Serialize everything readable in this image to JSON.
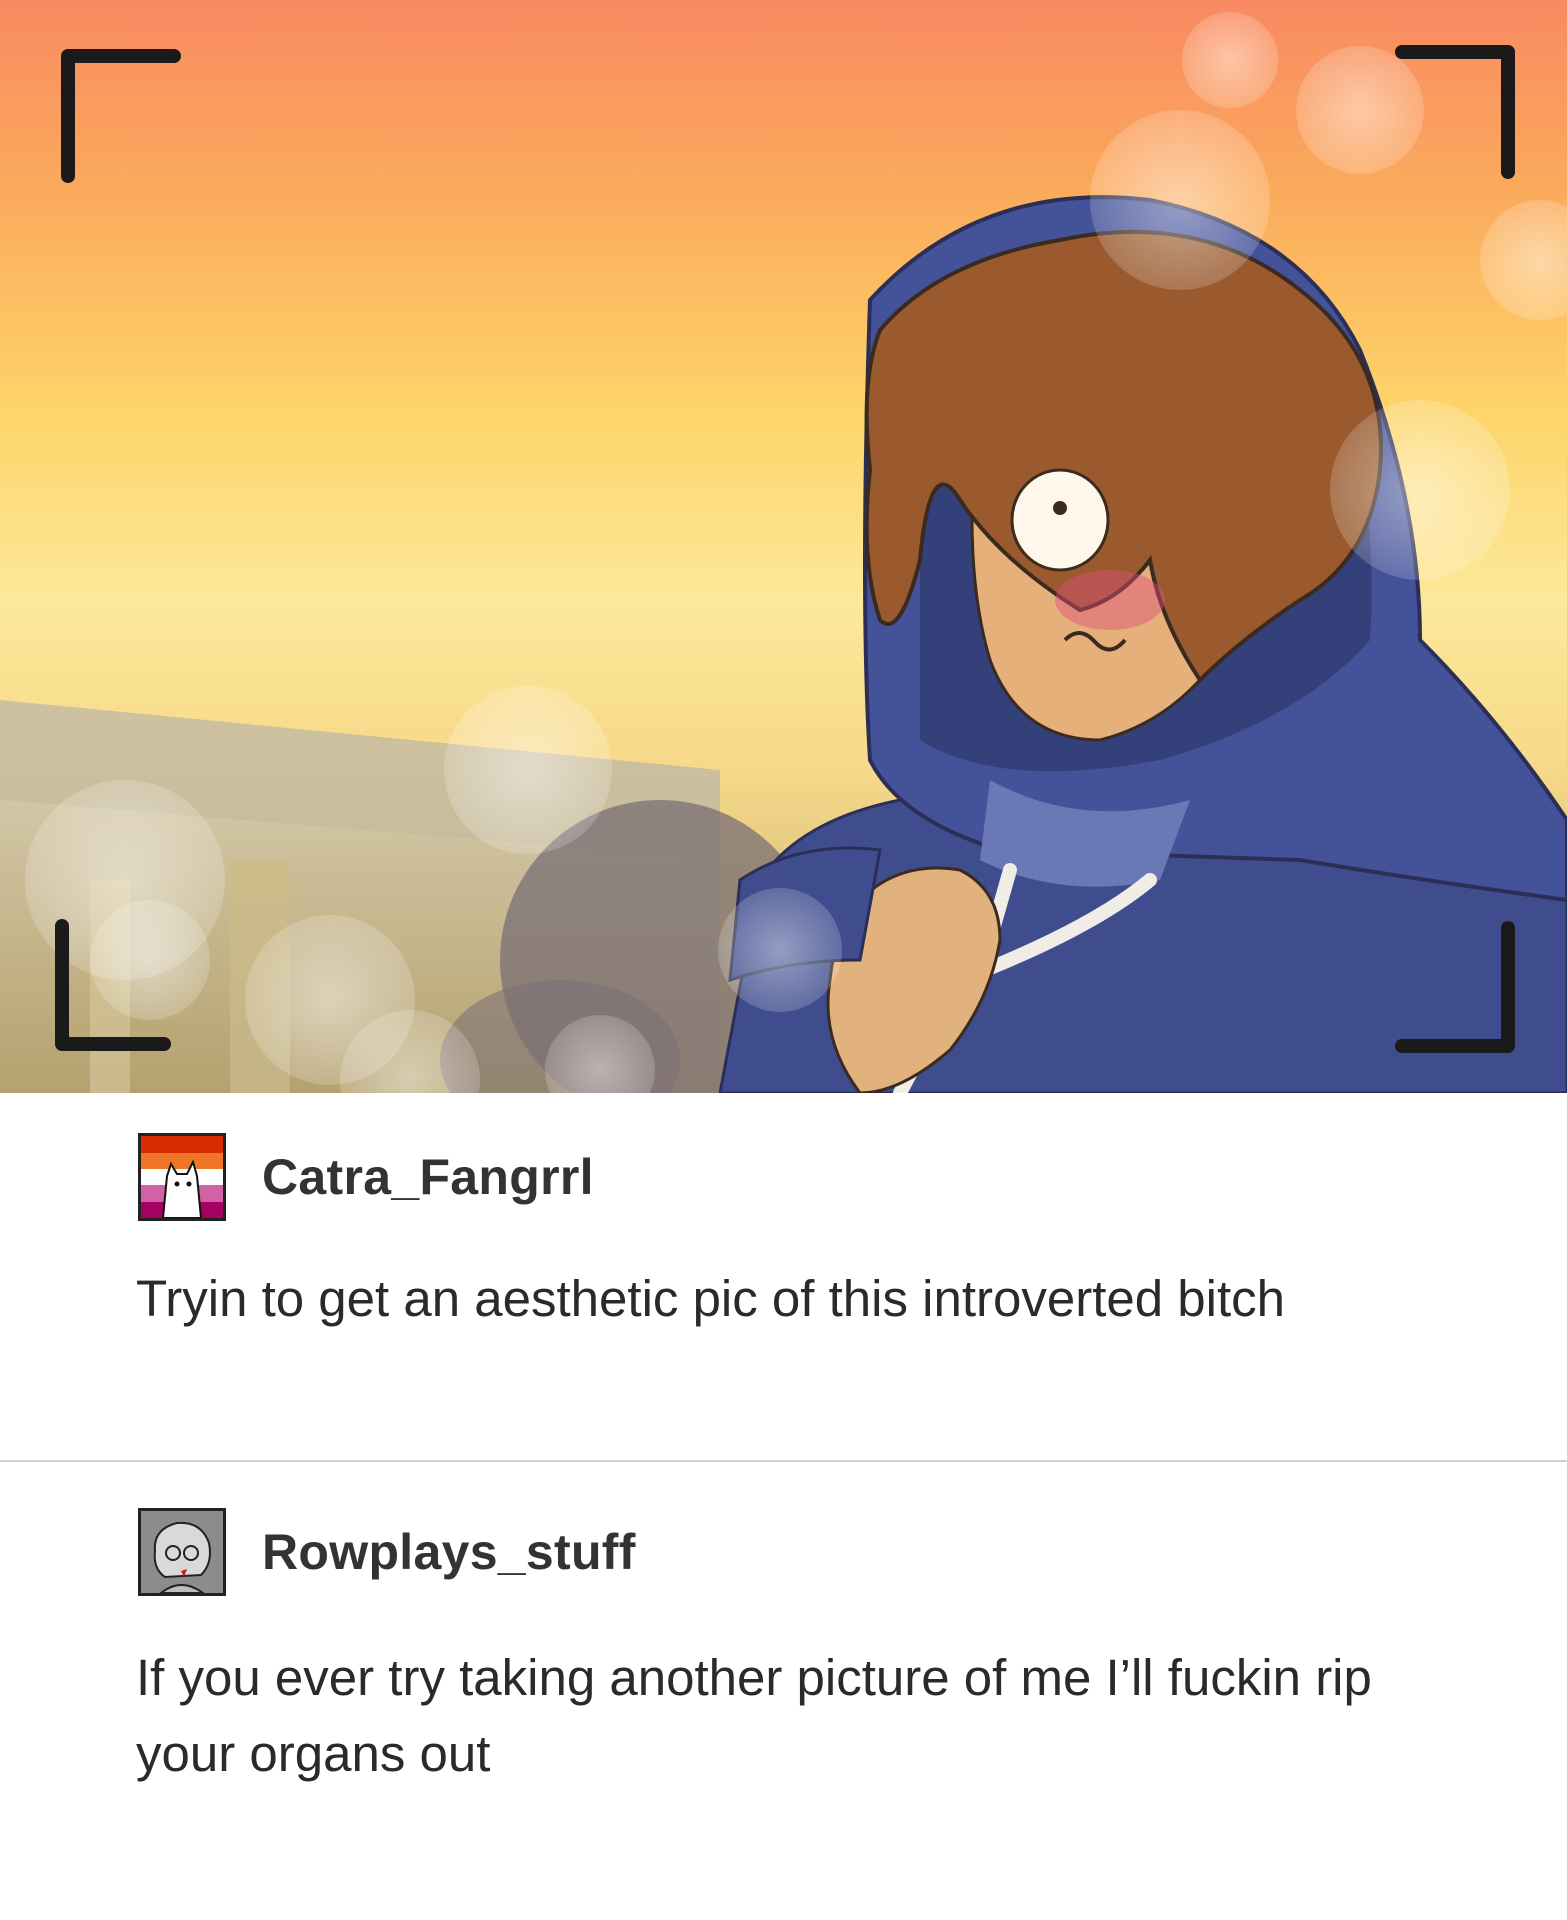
{
  "posts": [
    {
      "username": "Catra_Fangrrl",
      "avatar_icon": "lesbian-flag-cat-avatar-icon",
      "text": "Tryin to get an aesthetic pic of this introverted bitch"
    },
    {
      "username": "Rowplays_stuff",
      "avatar_icon": "grey-sketch-character-avatar-icon",
      "text": "If you ever try taking another picture of me I’ll fuckin rip your organs out"
    }
  ],
  "colors": {
    "sky_top": "#f98a62",
    "sky_bottom": "#fde89a",
    "hoodie": "#3f4d8f",
    "hair": "#9a5a2e",
    "username_text": "#333333",
    "body_text": "#2a2a2a"
  }
}
